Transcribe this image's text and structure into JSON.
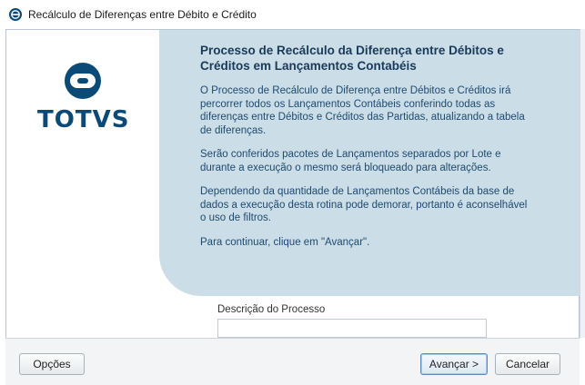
{
  "window": {
    "title": "Recálculo de Diferenças entre Débito e Crédito"
  },
  "brand": {
    "logo_text": "TOTVS",
    "color_primary": "#0b4a76"
  },
  "info": {
    "title": "Processo de Recálculo da Diferença entre Débitos e Créditos em Lançamentos Contabéis",
    "paragraphs": [
      "O Processo de Recálculo de Diferença entre Débitos e Créditos irá percorrer todos os Lançamentos Contábeis conferindo todas as diferenças entre Débitos e Créditos das Partidas, atualizando a tabela de diferenças.",
      "Serão conferidos pacotes de Lançamentos separados por Lote e durante a execução o mesmo será bloqueado para alterações.",
      "Dependendo da quantidade de Lançamentos Contábeis da base de dados a execução desta rotina pode demorar, portanto é aconselhável o uso de filtros.",
      "Para continuar, clique em \"Avançar\"."
    ],
    "panel_color": "#cbdde6"
  },
  "form": {
    "description_label": "Descrição do Processo",
    "description_value": ""
  },
  "footer": {
    "options_label": "Opções",
    "next_label": "Avançar >",
    "cancel_label": "Cancelar"
  }
}
